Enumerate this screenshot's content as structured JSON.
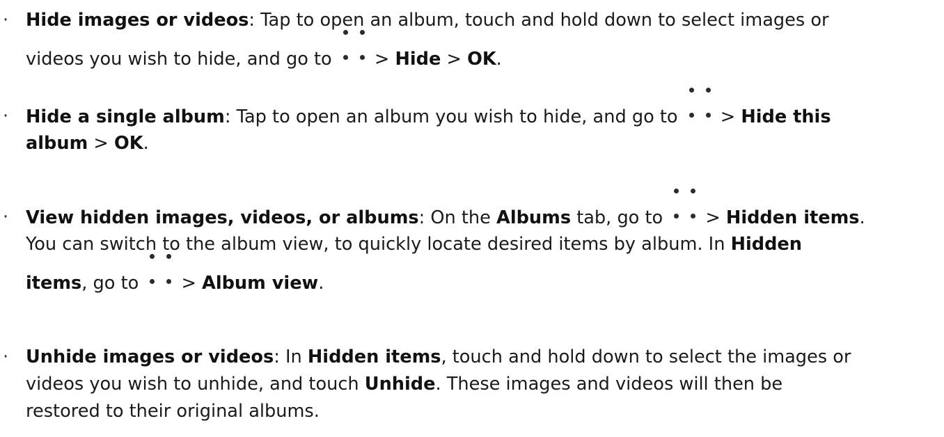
{
  "bullet_symbol": "·",
  "icons": {
    "menu": "more-options-dots-icon"
  },
  "item1": {
    "title": "Hide images or videos",
    "t1": ": Tap to open an album, touch and hold down to select images or",
    "t2": "videos you wish to hide, and go to",
    "t3": ">",
    "b1": "Hide",
    "t4": ">",
    "b2": "OK",
    "t5": "."
  },
  "item2": {
    "title": "Hide a single album",
    "t1": ": Tap to open an album you wish to hide, and go to",
    "t2": ">",
    "b1": "Hide this",
    "b2": "album",
    "t3": ">",
    "b3": "OK",
    "t4": "."
  },
  "item3": {
    "title": "View hidden images, videos, or albums",
    "t1": ": On the",
    "b1": "Albums",
    "t2": "tab, go to",
    "t3": ">",
    "b2": "Hidden items",
    "t4": ".",
    "t5": "You can switch to the album view, to quickly locate desired items by album. In",
    "b3": "Hidden",
    "b4": "items",
    "t6": ", go to",
    "t7": ">",
    "b5": "Album view",
    "t8": "."
  },
  "item4": {
    "title": "Unhide images or videos",
    "t1": ": In",
    "b1": "Hidden items",
    "t2": ", touch and hold down to select the images or",
    "t3": "videos you wish to unhide, and touch",
    "b2": "Unhide",
    "t4": ". These images and videos will then be",
    "t5": "restored to their original albums."
  }
}
